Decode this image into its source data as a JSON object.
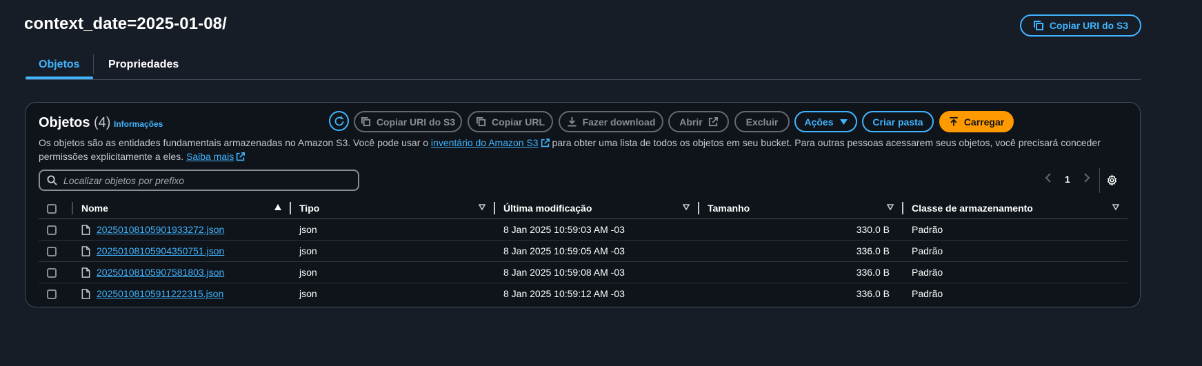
{
  "page": {
    "title": "context_date=2025-01-08/",
    "copy_uri_button": "Copiar URI do S3"
  },
  "tabs": [
    {
      "label": "Objetos",
      "active": true
    },
    {
      "label": "Propriedades",
      "active": false
    }
  ],
  "objects_panel": {
    "heading": "Objetos",
    "count": "(4)",
    "info_link": "Informações",
    "toolbar": {
      "copy_uri": "Copiar URI do S3",
      "copy_url": "Copiar URL",
      "download": "Fazer download",
      "open": "Abrir",
      "delete": "Excluir",
      "actions": "Ações",
      "create_folder": "Criar pasta",
      "upload": "Carregar"
    },
    "description": {
      "text_before": "Os objetos são as entidades fundamentais armazenadas no Amazon S3. Você pode usar o ",
      "inventory_link": "inventário do Amazon S3",
      "text_middle": " para obter uma lista de todos os objetos em seu bucket. Para outras pessoas acessarem seus objetos, você precisará conceder permissões explicitamente a eles. ",
      "learn_more_link": "Saiba mais"
    },
    "search": {
      "placeholder": "Localizar objetos por prefixo"
    },
    "pagination": {
      "current_page": "1"
    },
    "table": {
      "columns": [
        "Nome",
        "Tipo",
        "Última modificação",
        "Tamanho",
        "Classe de armazenamento"
      ],
      "rows": [
        {
          "name": "20250108105901933272.json",
          "type": "json",
          "modified": "8 Jan 2025 10:59:03 AM -03",
          "size": "330.0 B",
          "storage_class": "Padrão"
        },
        {
          "name": "20250108105904350751.json",
          "type": "json",
          "modified": "8 Jan 2025 10:59:05 AM -03",
          "size": "336.0 B",
          "storage_class": "Padrão"
        },
        {
          "name": "20250108105907581803.json",
          "type": "json",
          "modified": "8 Jan 2025 10:59:08 AM -03",
          "size": "336.0 B",
          "storage_class": "Padrão"
        },
        {
          "name": "20250108105911222315.json",
          "type": "json",
          "modified": "8 Jan 2025 10:59:12 AM -03",
          "size": "336.0 B",
          "storage_class": "Padrão"
        }
      ]
    }
  },
  "colors": {
    "background": "#161d26",
    "panel": "#0f141a",
    "link": "#42b4ff",
    "primary": "#ff9900"
  }
}
